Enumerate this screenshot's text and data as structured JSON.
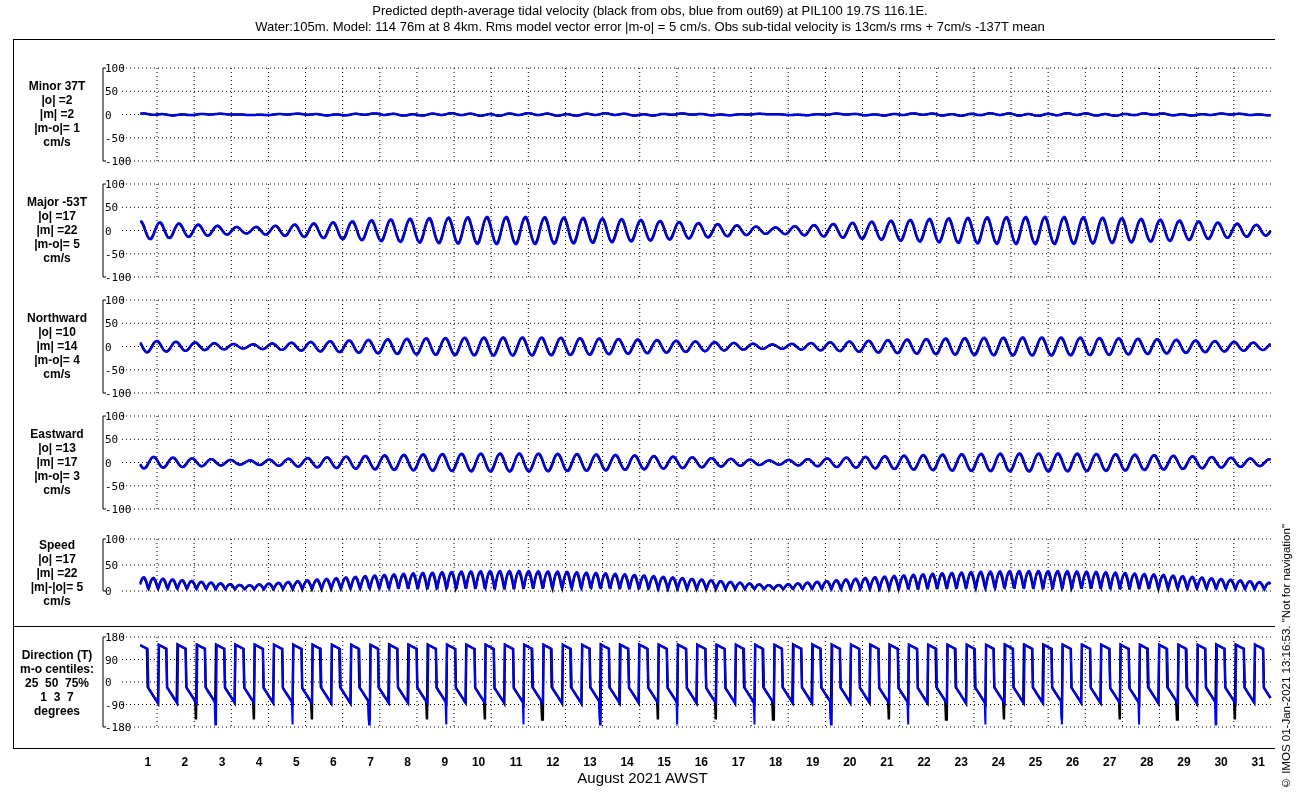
{
  "title_lines": [
    "Predicted depth-average tidal velocity (black from obs, blue from out69) at PIL100 19.7S 116.1E.",
    "Water:105m. Model: 114 76m at 8 4km. Rms model vector error |m-o| = 5 cm/s. Obs sub-tidal velocity is 13cm/s rms + 7cm/s -137T mean"
  ],
  "panels": [
    {
      "kind": "velocity",
      "label_lines": [
        "Minor 37T",
        "|o| =2",
        "|m| =2",
        "|m-o|= 1",
        "cm/s"
      ],
      "yticks": [
        "100",
        "50",
        "0",
        "-50",
        "-100"
      ]
    },
    {
      "kind": "velocity",
      "label_lines": [
        "Major -53T",
        "|o| =17",
        "|m| =22",
        "|m-o|= 5",
        "cm/s"
      ],
      "yticks": [
        "100",
        "50",
        "0",
        "-50",
        "-100"
      ]
    },
    {
      "kind": "velocity",
      "label_lines": [
        "Northward",
        "|o| =10",
        "|m| =14",
        "|m-o|= 4",
        "cm/s"
      ],
      "yticks": [
        "100",
        "50",
        "0",
        "-50",
        "-100"
      ]
    },
    {
      "kind": "velocity",
      "label_lines": [
        "Eastward",
        "|o| =13",
        "|m| =17",
        "|m-o|= 3",
        "cm/s"
      ],
      "yticks": [
        "100",
        "50",
        "0",
        "-50",
        "-100"
      ]
    },
    {
      "kind": "speed",
      "label_lines": [
        "Speed",
        "|o| =17",
        "|m| =22",
        "|m|-|o|= 5",
        "cm/s"
      ],
      "yticks": [
        "100",
        "50",
        "0"
      ]
    },
    {
      "kind": "direction",
      "label_lines": [
        "Direction (T)",
        "m-o centiles:",
        "25  50  75%",
        "1  3  7",
        "degrees"
      ],
      "yticks": [
        "180",
        "90",
        "0",
        "-90",
        "-180"
      ]
    }
  ],
  "xticks": [
    "1",
    "2",
    "3",
    "4",
    "5",
    "6",
    "7",
    "8",
    "9",
    "10",
    "11",
    "12",
    "13",
    "14",
    "15",
    "16",
    "17",
    "18",
    "19",
    "20",
    "21",
    "22",
    "23",
    "24",
    "25",
    "26",
    "27",
    "28",
    "29",
    "30",
    "31"
  ],
  "xlabel": "August 2021 AWST",
  "credit": "© IMOS 01-Jan-2021 13:16:53. \"Not for navigation\""
}
